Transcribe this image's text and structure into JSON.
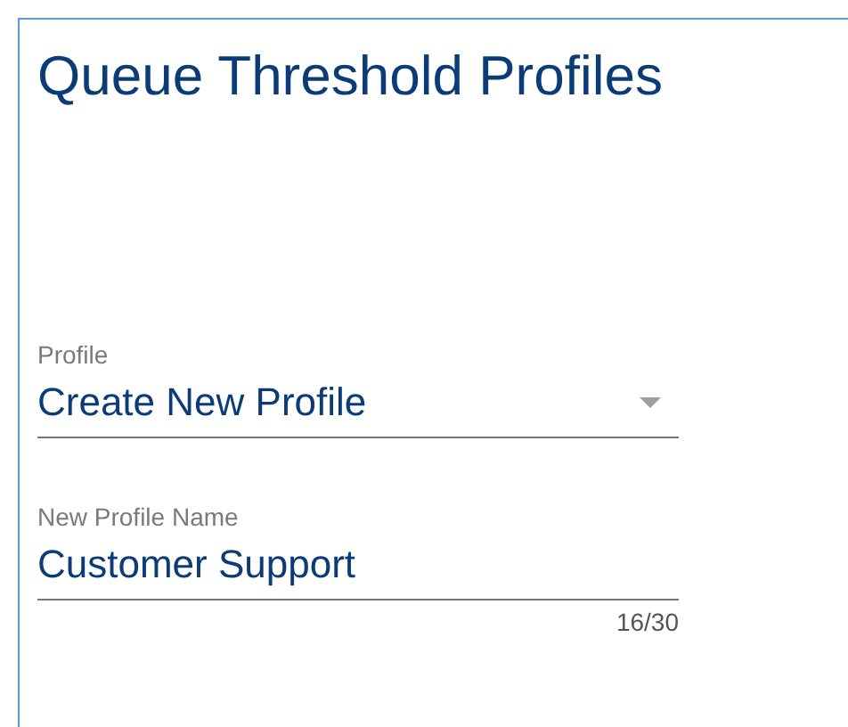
{
  "title": "Queue Threshold Profiles",
  "profile_select": {
    "label": "Profile",
    "value": "Create New Profile"
  },
  "name_field": {
    "label": "New Profile Name",
    "value": "Customer Support",
    "counter": "16/30"
  }
}
